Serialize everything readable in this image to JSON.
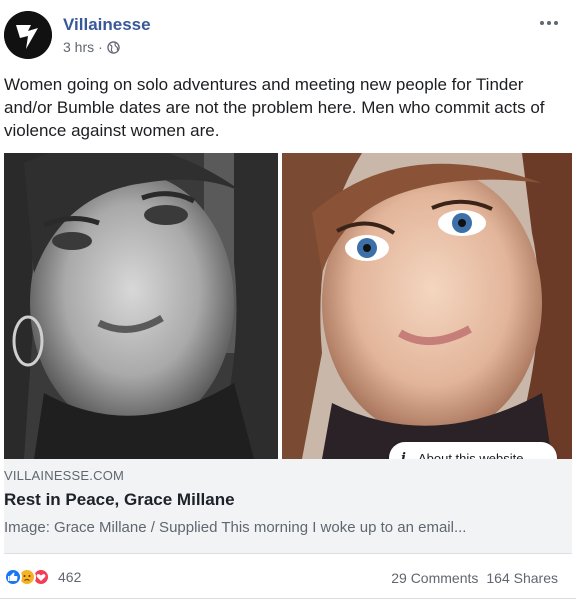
{
  "page": {
    "name": "Villainesse",
    "timestamp": "3 hrs",
    "audience_icon": "globe-icon",
    "menu_icon": "more-options-icon"
  },
  "post": {
    "text": "Women going on solo adventures and meeting new people for Tinder and/or Bumble dates are not the problem here. Men who commit acts of violence against women are."
  },
  "link_preview": {
    "about_label": "About this website",
    "domain": "VILLAINESSE.COM",
    "title": "Rest in Peace, Grace Millane",
    "description": "Image: Grace Millane / Supplied This morning I woke up to an email..."
  },
  "footer": {
    "reaction_icons": [
      "like-reaction-icon",
      "sad-reaction-icon",
      "love-reaction-icon"
    ],
    "reaction_count": "462",
    "comments": "29 Comments",
    "shares": "164 Shares"
  },
  "colors": {
    "link_blue": "#385898",
    "meta_gray": "#616770",
    "preview_bg": "#f2f3f5"
  }
}
